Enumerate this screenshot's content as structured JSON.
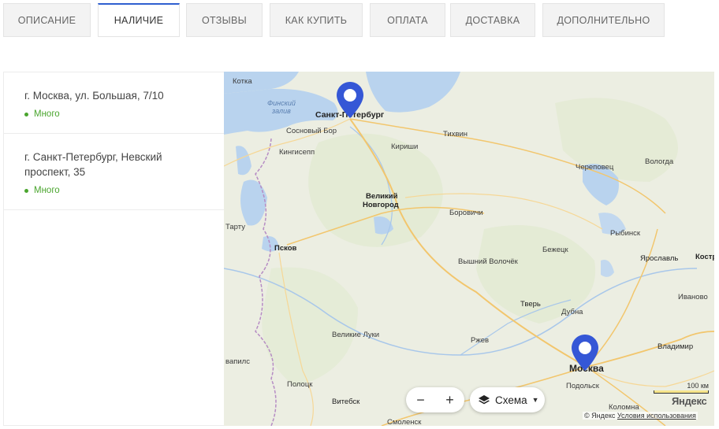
{
  "tabs": [
    {
      "label": "ОПИСАНИЕ",
      "active": false
    },
    {
      "label": "НАЛИЧИЕ",
      "active": true
    },
    {
      "label": "ОТЗЫВЫ",
      "active": false
    },
    {
      "label": "КАК КУПИТЬ",
      "active": false
    },
    {
      "label": "ОПЛАТА",
      "active": false
    },
    {
      "label": "ДОСТАВКА",
      "active": false
    },
    {
      "label": "ДОПОЛНИТЕЛЬНО",
      "active": false
    }
  ],
  "stores": [
    {
      "address": "г. Москва, ул. Большая, 7/10",
      "stock": "Много"
    },
    {
      "address": "г. Санкт-Петербург, Невский проспект, 35",
      "stock": "Много"
    }
  ],
  "map": {
    "cities": {
      "kotka": "Котка",
      "spb": "Санкт-Петербург",
      "sosnovy_bor": "Сосновый Бор",
      "kingisepp": "Кингисепп",
      "kirishi": "Кириши",
      "tikhvin": "Тихвин",
      "cherepovets": "Череповец",
      "vologda": "Вологда",
      "veliky_novgorod_1": "Великий",
      "veliky_novgorod_2": "Новгород",
      "borovichi": "Боровичи",
      "tartu": "Тарту",
      "pskov": "Псков",
      "bezhetsk": "Бежецк",
      "rybinsk": "Рыбинск",
      "yaroslavl": "Ярославль",
      "kostroma": "Костр",
      "vyshny_volochek": "Вышний Волочёк",
      "tver": "Тверь",
      "ivanovo": "Иваново",
      "dubna": "Дубна",
      "velikie_luki": "Великие Луки",
      "rzhev": "Ржев",
      "vladimir": "Владимир",
      "moscow": "Москва",
      "podolsk": "Подольск",
      "polotsk": "Полоцк",
      "vitebsk": "Витебск",
      "kolomna": "Коломна",
      "smolensk": "Смоленск",
      "daugavpils_frag": "вапилс"
    },
    "water": {
      "gulf_1": "Финский",
      "gulf_2": "залив"
    },
    "zoom_out": "−",
    "zoom_in": "+",
    "layers_label": "Схема",
    "layers_caret": "▼",
    "scale_label": "100 км",
    "logo": "Яндекс",
    "copyright": "© Яндекс",
    "terms_link": "Условия использования",
    "pin_color": "#3557d6"
  }
}
